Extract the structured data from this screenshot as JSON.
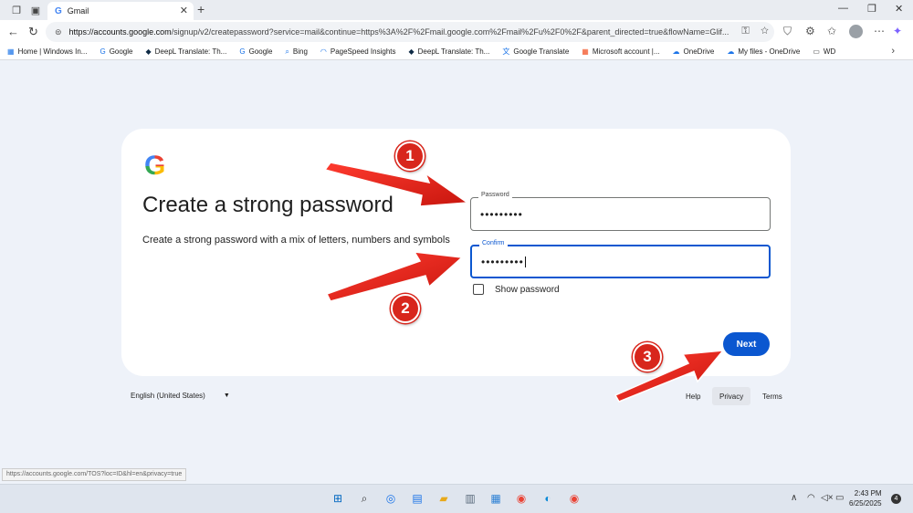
{
  "browser": {
    "tab_title": "Gmail",
    "url_domain": "https://accounts.google.com",
    "url_path": "/signup/v2/createpassword?service=mail&continue=https%3A%2F%2Fmail.google.com%2Fmail%2Fu%2F0%2F&parent_directed=true&flowName=Glif...",
    "bookmarks": [
      "Home | Windows In...",
      "Google",
      "DeepL Translate: Th...",
      "Google",
      "Bing",
      "PageSpeed Insights",
      "DeepL Translate: Th...",
      "Google Translate",
      "Microsoft account |...",
      "OneDrive",
      "My files - OneDrive",
      "WD"
    ],
    "status_url": "https://accounts.google.com/TOS?loc=ID&hl=en&privacy=true"
  },
  "page": {
    "title": "Create a strong password",
    "subtitle": "Create a strong password with a mix of letters, numbers and symbols",
    "password_label": "Password",
    "password_value": "•••••••••",
    "confirm_label": "Confirm",
    "confirm_value": "•••••••••",
    "show_password_label": "Show password",
    "next_label": "Next"
  },
  "footer": {
    "language": "English (United States)",
    "help": "Help",
    "privacy": "Privacy",
    "terms": "Terms"
  },
  "annotations": [
    "1",
    "2",
    "3"
  ],
  "taskbar": {
    "time": "2:43 PM",
    "date": "6/25/2025",
    "notifications": "4"
  },
  "colors": {
    "accent": "#0b57d0",
    "arrow": "#e8241a"
  }
}
